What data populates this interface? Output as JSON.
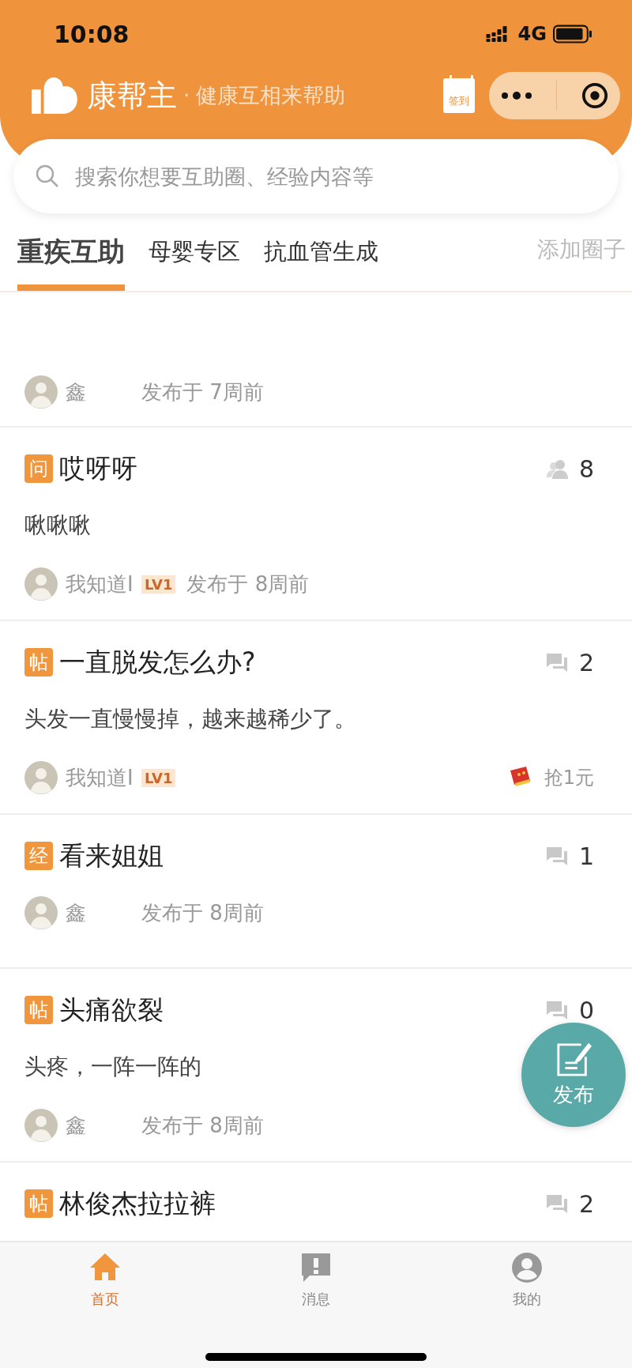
{
  "status_bar": {
    "time": "10:08",
    "network": "4G"
  },
  "header": {
    "app_name": "康帮主",
    "separator": "·",
    "slogan": "健康互相来帮助",
    "checkin_label": "签到"
  },
  "search": {
    "placeholder": "搜索你想要互助圈、经验内容等"
  },
  "tabs": [
    {
      "label": "重疾互助",
      "selected": true
    },
    {
      "label": "母婴专区",
      "selected": false
    },
    {
      "label": "抗血管生成",
      "selected": false
    }
  ],
  "add_circle": "添加圈子",
  "partial_post": {
    "author": "鑫",
    "published": "发布于 7周前"
  },
  "posts": [
    {
      "tag": "问",
      "title": "哎呀呀",
      "body": "啾啾啾",
      "kind": "people",
      "count": "8",
      "author": "我知道I",
      "level": "LV1",
      "published": "发布于 8周前"
    },
    {
      "tag": "帖",
      "title": "一直脱发怎么办?",
      "body": "头发一直慢慢掉，越来越稀少了。",
      "kind": "comments",
      "count": "2",
      "author": "我知道I",
      "level": "LV1",
      "reward": "抢1元"
    },
    {
      "tag": "经",
      "title": "看来姐姐",
      "kind": "comments",
      "count": "1",
      "author": "鑫",
      "published": "发布于 8周前"
    },
    {
      "tag": "帖",
      "title": "头痛欲裂",
      "body": "头疼，一阵一阵的",
      "kind": "comments",
      "count": "0",
      "author": "鑫",
      "published": "发布于 8周前"
    },
    {
      "tag": "帖",
      "title": "林俊杰拉拉裤",
      "kind": "comments",
      "count": "2"
    }
  ],
  "fab": {
    "label": "发布"
  },
  "tab_bar": [
    {
      "kind": "home",
      "label": "首页",
      "selected": true
    },
    {
      "kind": "message",
      "label": "消息",
      "selected": false
    },
    {
      "kind": "profile",
      "label": "我的",
      "selected": false
    }
  ]
}
